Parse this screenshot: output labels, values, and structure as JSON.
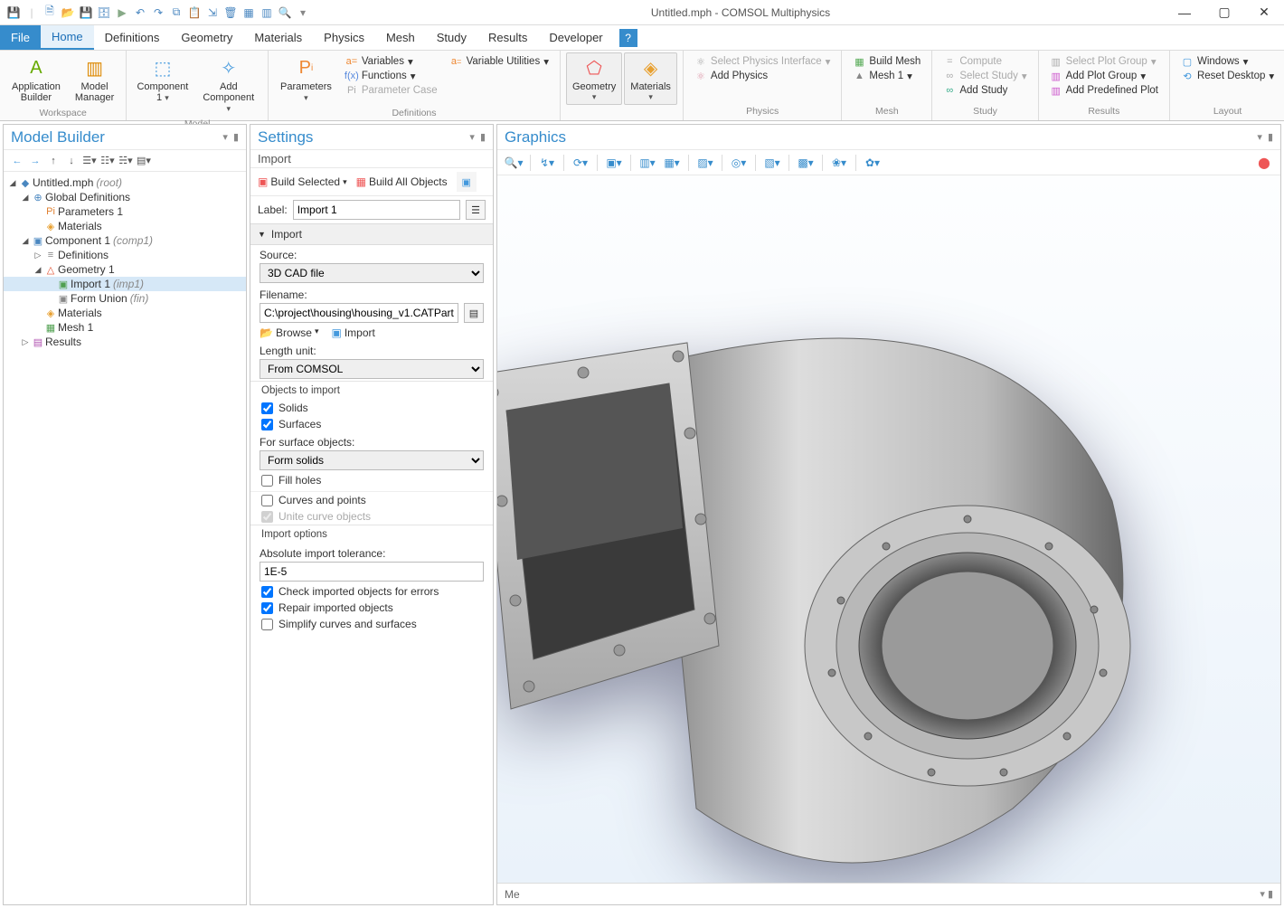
{
  "title": "Untitled.mph - COMSOL Multiphysics",
  "menuTabs": [
    "File",
    "Home",
    "Definitions",
    "Geometry",
    "Materials",
    "Physics",
    "Mesh",
    "Study",
    "Results",
    "Developer"
  ],
  "activeTab": "Home",
  "ribbon": {
    "workspace": {
      "label": "Workspace",
      "appBuilder": "Application\nBuilder",
      "modelManager": "Model\nManager"
    },
    "model": {
      "label": "Model",
      "component": "Component\n1",
      "addComponent": "Add\nComponent"
    },
    "definitions": {
      "label": "Definitions",
      "parameters": "Parameters",
      "variables": "Variables",
      "functions": "Functions",
      "paramCase": "Parameter Case",
      "varUtils": "Variable Utilities"
    },
    "geomMat": {
      "geometry": "Geometry",
      "materials": "Materials"
    },
    "physics": {
      "label": "Physics",
      "selPhys": "Select Physics Interface",
      "addPhys": "Add Physics"
    },
    "mesh": {
      "label": "Mesh",
      "buildMesh": "Build Mesh",
      "mesh1": "Mesh 1"
    },
    "study": {
      "label": "Study",
      "compute": "Compute",
      "selStudy": "Select Study",
      "addStudy": "Add Study"
    },
    "results": {
      "label": "Results",
      "selPlot": "Select Plot Group",
      "addPlot": "Add Plot Group",
      "addPredef": "Add Predefined Plot"
    },
    "layout": {
      "label": "Layout",
      "windows": "Windows",
      "reset": "Reset Desktop"
    }
  },
  "modelBuilder": {
    "title": "Model Builder",
    "tree": [
      {
        "indent": 0,
        "tw": "◢",
        "ic": "◆",
        "iconColor": "#4a87c0",
        "label": "Untitled.mph",
        "suffix": "(root)"
      },
      {
        "indent": 1,
        "tw": "◢",
        "ic": "⊕",
        "iconColor": "#4a87c0",
        "label": "Global Definitions"
      },
      {
        "indent": 2,
        "tw": "",
        "ic": "Pi",
        "iconColor": "#e08030",
        "label": "Parameters 1"
      },
      {
        "indent": 2,
        "tw": "",
        "ic": "◈",
        "iconColor": "#e8a030",
        "label": "Materials"
      },
      {
        "indent": 1,
        "tw": "◢",
        "ic": "▣",
        "iconColor": "#4a87c0",
        "label": "Component 1",
        "suffix": "(comp1)"
      },
      {
        "indent": 2,
        "tw": "▷",
        "ic": "≡",
        "iconColor": "#888",
        "label": "Definitions"
      },
      {
        "indent": 2,
        "tw": "◢",
        "ic": "△",
        "iconColor": "#e05030",
        "label": "Geometry 1"
      },
      {
        "indent": 3,
        "tw": "",
        "ic": "▣",
        "iconColor": "#50a050",
        "label": "Import 1",
        "suffix": "(imp1)",
        "selected": true
      },
      {
        "indent": 3,
        "tw": "",
        "ic": "▣",
        "iconColor": "#888",
        "label": "Form Union",
        "suffix": "(fin)"
      },
      {
        "indent": 2,
        "tw": "",
        "ic": "◈",
        "iconColor": "#e8a030",
        "label": "Materials"
      },
      {
        "indent": 2,
        "tw": "",
        "ic": "▦",
        "iconColor": "#50a050",
        "label": "Mesh 1"
      },
      {
        "indent": 1,
        "tw": "▷",
        "ic": "▤",
        "iconColor": "#b050b0",
        "label": "Results"
      }
    ]
  },
  "settings": {
    "title": "Settings",
    "subtitle": "Import",
    "buildSelected": "Build Selected",
    "buildAll": "Build All Objects",
    "labelLbl": "Label:",
    "labelVal": "Import 1",
    "sectionImport": "Import",
    "sourceLbl": "Source:",
    "sourceVal": "3D CAD file",
    "filenameLbl": "Filename:",
    "filenameVal": "C:\\project\\housing\\housing_v1.CATPart",
    "browse": "Browse",
    "import": "Import",
    "lengthUnitLbl": "Length unit:",
    "lengthUnitVal": "From COMSOL",
    "objectsHead": "Objects to import",
    "solids": "Solids",
    "surfaces": "Surfaces",
    "forSurface": "For surface objects:",
    "formSolids": "Form solids",
    "fillHoles": "Fill holes",
    "curvesPoints": "Curves and points",
    "uniteCurve": "Unite curve objects",
    "importOptions": "Import options",
    "absTolLbl": "Absolute import tolerance:",
    "absTolVal": "1E-5",
    "checkErrors": "Check imported objects for errors",
    "repairImported": "Repair imported objects",
    "simplify": "Simplify curves and surfaces"
  },
  "graphics": {
    "title": "Graphics",
    "msgTab": "Me"
  }
}
